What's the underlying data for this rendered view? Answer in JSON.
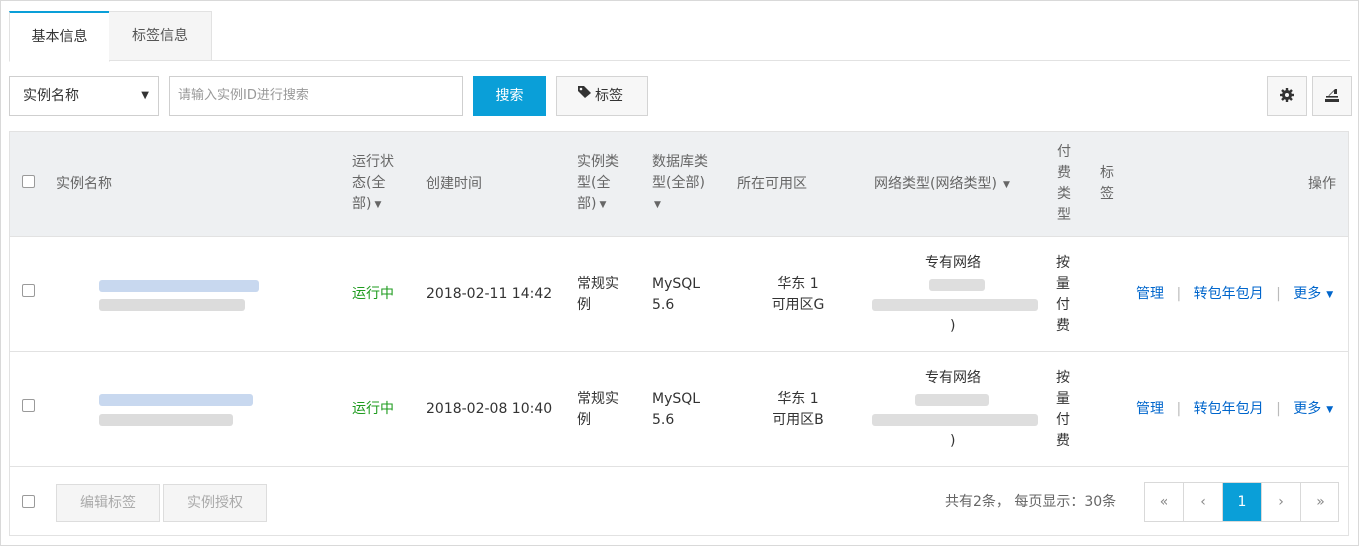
{
  "tabs": [
    {
      "label": "基本信息"
    },
    {
      "label": "标签信息"
    }
  ],
  "toolbar": {
    "filter_select": "实例名称",
    "search_placeholder": "请输入实例ID进行搜索",
    "search_label": "搜索",
    "tag_label": "标签"
  },
  "table": {
    "headers": {
      "name": "实例名称",
      "status": [
        "运行状",
        "态(全",
        "部)"
      ],
      "created": "创建时间",
      "type": [
        "实例类",
        "型(全",
        "部)"
      ],
      "db_type": [
        "数据库类",
        "型(全部)"
      ],
      "zone": "所在可用区",
      "network": "网络类型(网络类型)",
      "billing": [
        "付",
        "费",
        "类",
        "型"
      ],
      "tag": [
        "标",
        "签"
      ],
      "actions": "操作"
    },
    "rows": [
      {
        "status": "运行中",
        "created": "2018-02-11 14:42",
        "type": [
          "常规实",
          "例"
        ],
        "db": [
          "MySQL",
          "5.6"
        ],
        "zone": [
          "华东 1",
          "可用区G"
        ],
        "network": "专有网络",
        "network_tail": ")",
        "billing": [
          "按",
          "量",
          "付",
          "费"
        ],
        "actions": {
          "manage": "管理",
          "renew": "转包年包月",
          "more": "更多"
        }
      },
      {
        "status": "运行中",
        "created": "2018-02-08 10:40",
        "type": [
          "常规实",
          "例"
        ],
        "db": [
          "MySQL",
          "5.6"
        ],
        "zone": [
          "华东 1",
          "可用区B"
        ],
        "network": "专有网络",
        "network_tail": ")",
        "billing": [
          "按",
          "量",
          "付",
          "费"
        ],
        "actions": {
          "manage": "管理",
          "renew": "转包年包月",
          "more": "更多"
        }
      }
    ]
  },
  "footer": {
    "edit_tags": "编辑标签",
    "authorize": "实例授权",
    "total_text": "共有2条， 每页显示：30条",
    "pager": {
      "first": "«",
      "prev": "‹",
      "current": "1",
      "next": "›",
      "last": "»"
    }
  },
  "colors": {
    "accent": "#0a9fd8",
    "status_running": "#1e9b1e",
    "link": "#0066cc"
  }
}
